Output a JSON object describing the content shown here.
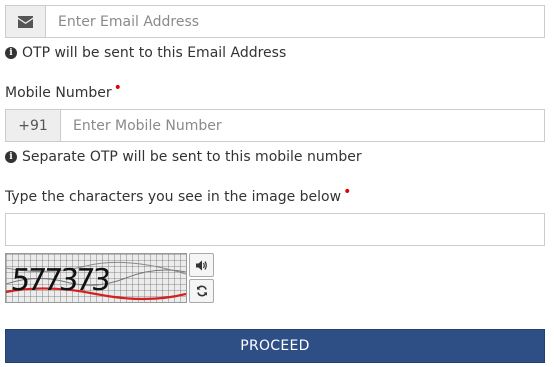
{
  "email": {
    "placeholder": "Enter Email Address",
    "icon": "envelope-icon",
    "help_text": "OTP will be sent to this Email Address"
  },
  "mobile": {
    "label": "Mobile Number",
    "required_marker": "•",
    "prefix": "+91",
    "placeholder": "Enter Mobile Number",
    "help_text": "Separate OTP will be sent to this mobile number"
  },
  "captcha": {
    "label": "Type the characters you see in the image below",
    "required_marker": "•",
    "input_value": "",
    "image_text": "577373",
    "audio_icon": "speaker-icon",
    "refresh_icon": "refresh-icon"
  },
  "proceed_label": "PROCEED",
  "colors": {
    "primary": "#2d4f86",
    "required": "#e00000",
    "border": "#cccccc",
    "addon_bg": "#eeeeee"
  }
}
